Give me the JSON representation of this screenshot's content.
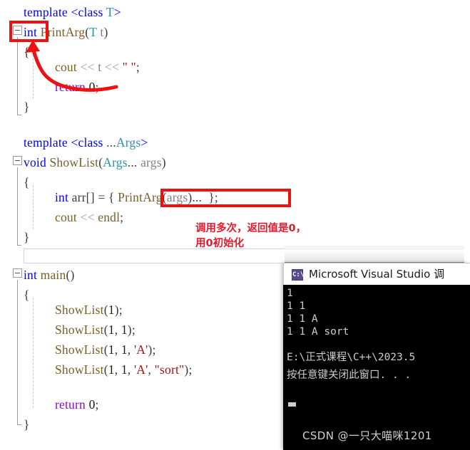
{
  "editor": {
    "blocks": [
      {
        "id": "printarg",
        "lines": [
          "template <class T>",
          "int PrintArg(T t)",
          "{",
          "    cout << t << \" \";",
          "    return 0;",
          "}"
        ]
      },
      {
        "id": "showlist",
        "lines": [
          "template <class ...Args>",
          "void ShowList(Args... args)",
          "{",
          "    int arr[] = { PrintArg(args)... };",
          "    cout << endl;",
          "}"
        ]
      },
      {
        "id": "main",
        "lines": [
          "int main()",
          "{",
          "    ShowList(1);",
          "    ShowList(1, 1);",
          "    ShowList(1, 1, 'A');",
          "    ShowList(1, 1, 'A', \"sort\");",
          "",
          "    return 0;",
          "}"
        ]
      }
    ],
    "tokens": {
      "t_template": "template",
      "t_lt": "<",
      "t_class": "class",
      "t_T": "T",
      "t_gt": ">",
      "t_int": "int",
      "t_printarg": "PrintArg",
      "t_paren_open": "(",
      "t_paren_close": ")",
      "t_t": "t",
      "t_open_brace": "{",
      "t_close_brace": "}",
      "t_cout": "cout",
      "t_shift": "<<",
      "t_spacestr": "\" \"",
      "t_semi": ";",
      "t_return": "return",
      "t_zero": "0",
      "t_ellipsis": "...",
      "t_args_type": "Args",
      "t_void": "void",
      "t_showlist": "ShowList",
      "t_args": "args",
      "t_arr": "arr[]",
      "t_eq": "=",
      "t_endl": "endl",
      "t_main": "main",
      "t_one": "1",
      "t_comma": ",",
      "t_charA": "'A'",
      "t_sortstr": "\"sort\""
    },
    "annotations": {
      "note_line1": "调用多次，返回值是0，",
      "note_line2": "用0初始化",
      "highlight_return_type": "int",
      "highlight_pack_expansion": "PrintArg(args)..."
    }
  },
  "console": {
    "title": "Microsoft Visual Studio 调",
    "icon": "console-app-icon",
    "icon_glyph": "C:\\",
    "output_lines": [
      "1",
      "1 1",
      "1 1 A",
      "1 1 A sort",
      "",
      "E:\\正式课程\\C++\\2023.5",
      "按任意键关闭此窗口. . ."
    ]
  },
  "watermark": {
    "text": "CSDN @一只大喵咪1201"
  },
  "colors": {
    "keyword": "#0000ff",
    "type": "#2b91af",
    "function": "#795e26",
    "string": "#a31515",
    "return_keyword": "#8f08c4",
    "annotation_red": "#e8192c",
    "box_red": "#ee1111",
    "console_bg": "#000000",
    "console_fg": "#cccccc"
  }
}
